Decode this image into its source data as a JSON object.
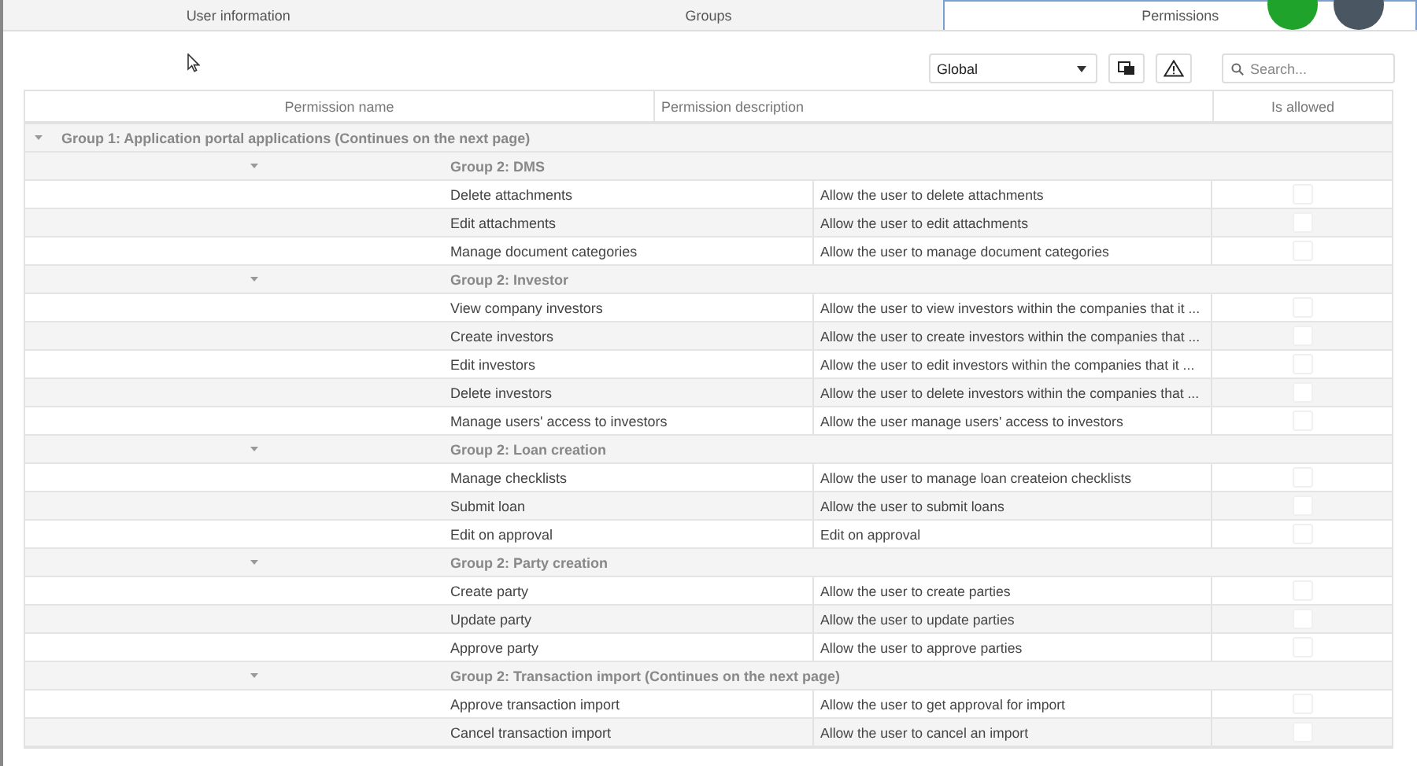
{
  "tabs": [
    {
      "label": "User information",
      "selected": false
    },
    {
      "label": "Groups",
      "selected": false
    },
    {
      "label": "Permissions",
      "selected": true
    }
  ],
  "toolbar": {
    "scope": "Global",
    "search": {
      "placeholder": "Search..."
    }
  },
  "table": {
    "columns": [
      "Permission name",
      "Permission description",
      "Is allowed"
    ],
    "groups": [
      {
        "label": "Group 1: Application portal applications (Continues on the next page)",
        "expanded": true,
        "children": [
          {
            "label": "Group 2: DMS",
            "expanded": true,
            "rows": [
              {
                "name": "Delete attachments",
                "description": "Allow the user to delete attachments",
                "allowed": false
              },
              {
                "name": "Edit attachments",
                "description": "Allow the user to edit attachments",
                "allowed": false
              },
              {
                "name": "Manage document categories",
                "description": "Allow the user to manage document categories",
                "allowed": false
              }
            ]
          },
          {
            "label": "Group 2: Investor",
            "expanded": true,
            "rows": [
              {
                "name": "View company investors",
                "description": "Allow the user to view investors within the companies that it ...",
                "allowed": false
              },
              {
                "name": "Create investors",
                "description": "Allow the user to create investors within the companies that ...",
                "allowed": false
              },
              {
                "name": "Edit investors",
                "description": "Allow the user to edit investors within the companies that it ...",
                "allowed": false
              },
              {
                "name": "Delete investors",
                "description": "Allow the user to delete investors within the companies that ...",
                "allowed": false
              },
              {
                "name": "Manage users' access to investors",
                "description": "Allow the user manage users' access to investors",
                "allowed": false
              }
            ]
          },
          {
            "label": "Group 2: Loan creation",
            "expanded": true,
            "rows": [
              {
                "name": "Manage checklists",
                "description": "Allow the user to manage loan createion checklists",
                "allowed": false
              },
              {
                "name": "Submit loan",
                "description": "Allow the user to submit loans",
                "allowed": false
              },
              {
                "name": "Edit on approval",
                "description": "Edit on approval",
                "allowed": false
              }
            ]
          },
          {
            "label": "Group 2: Party creation",
            "expanded": true,
            "rows": [
              {
                "name": "Create party",
                "description": "Allow the user to create parties",
                "allowed": false
              },
              {
                "name": "Update party",
                "description": "Allow the user to update parties",
                "allowed": false
              },
              {
                "name": "Approve party",
                "description": "Allow the user to approve parties",
                "allowed": false
              }
            ]
          },
          {
            "label": "Group 2: Transaction import (Continues on the next page)",
            "expanded": true,
            "rows": [
              {
                "name": "Approve transaction import",
                "description": "Allow the user to get approval for import",
                "allowed": false
              },
              {
                "name": "Cancel transaction import",
                "description": "Allow the user to cancel an import",
                "allowed": false
              }
            ]
          }
        ]
      }
    ]
  }
}
